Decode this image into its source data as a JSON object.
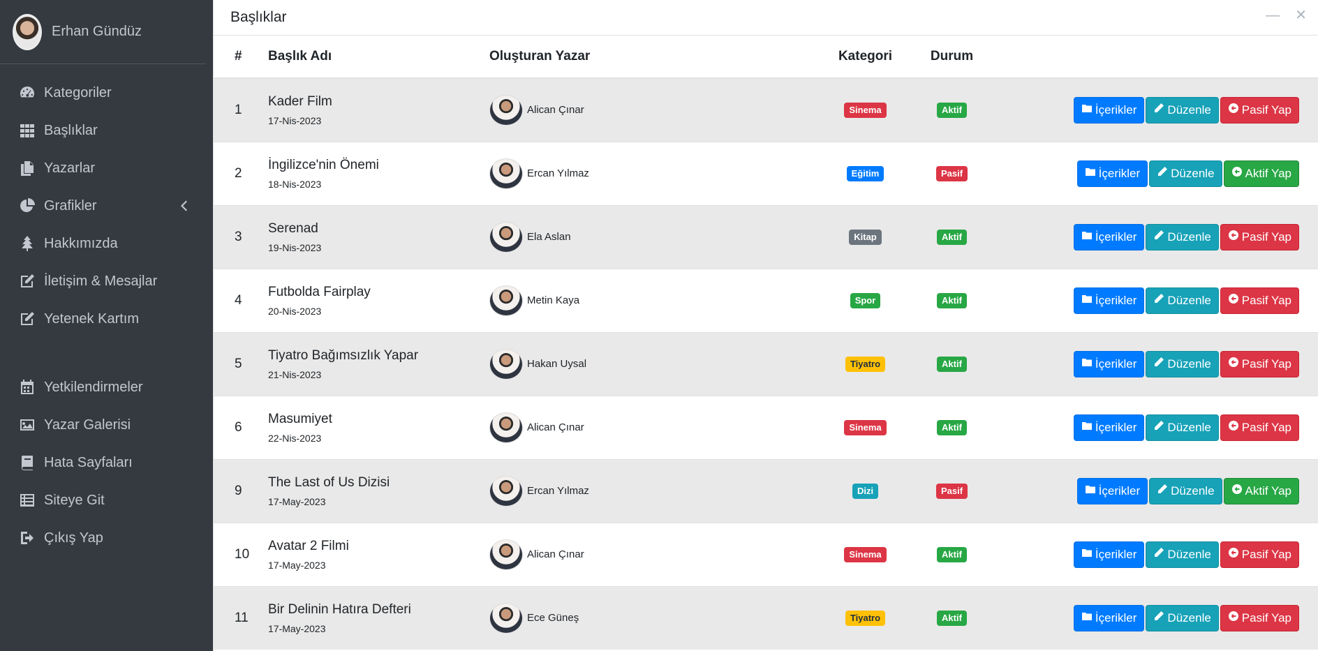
{
  "user": {
    "name": "Erhan Gündüz"
  },
  "sidebar": {
    "items": [
      {
        "label": "Kategoriler",
        "icon": "dashboard-icon"
      },
      {
        "label": "Başlıklar",
        "icon": "grid-icon"
      },
      {
        "label": "Yazarlar",
        "icon": "copy-icon"
      },
      {
        "label": "Grafikler",
        "icon": "pie-chart-icon"
      },
      {
        "label": "Hakkımızda",
        "icon": "tree-icon"
      },
      {
        "label": "İletişim & Mesajlar",
        "icon": "edit-icon"
      },
      {
        "label": "Yetenek Kartım",
        "icon": "edit-icon"
      },
      {
        "label": "Yetkilendirmeler",
        "icon": "calendar-icon"
      },
      {
        "label": "Yazar Galerisi",
        "icon": "image-icon"
      },
      {
        "label": "Hata Sayfaları",
        "icon": "book-icon"
      },
      {
        "label": "Siteye Git",
        "icon": "list-icon"
      },
      {
        "label": "Çıkış Yap",
        "icon": "sign-out-icon"
      }
    ]
  },
  "card": {
    "title": "Başlıklar",
    "minimize": "—",
    "close": "✕"
  },
  "table": {
    "headers": {
      "num": "#",
      "title": "Başlık Adı",
      "author": "Oluşturan Yazar",
      "category": "Kategori",
      "status": "Durum"
    },
    "rows": [
      {
        "num": "1",
        "title": "Kader Film",
        "date": "17-Nis-2023",
        "author": "Alican Çınar",
        "category": "Sinema",
        "cat_class": "b-red",
        "status": "Aktif",
        "stat_class": "b-green",
        "toggle": "Pasif Yap",
        "toggle_class": "btn-danger"
      },
      {
        "num": "2",
        "title": "İngilizce'nin Önemi",
        "date": "18-Nis-2023",
        "author": "Ercan Yılmaz",
        "category": "Eğitim",
        "cat_class": "b-blue",
        "status": "Pasif",
        "stat_class": "b-red",
        "toggle": "Aktif Yap",
        "toggle_class": "btn-success"
      },
      {
        "num": "3",
        "title": "Serenad",
        "date": "19-Nis-2023",
        "author": "Ela Aslan",
        "category": "Kitap",
        "cat_class": "b-gray",
        "status": "Aktif",
        "stat_class": "b-green",
        "toggle": "Pasif Yap",
        "toggle_class": "btn-danger"
      },
      {
        "num": "4",
        "title": "Futbolda Fairplay",
        "date": "20-Nis-2023",
        "author": "Metin Kaya",
        "category": "Spor",
        "cat_class": "b-green",
        "status": "Aktif",
        "stat_class": "b-green",
        "toggle": "Pasif Yap",
        "toggle_class": "btn-danger"
      },
      {
        "num": "5",
        "title": "Tiyatro Bağımsızlık Yapar",
        "date": "21-Nis-2023",
        "author": "Hakan Uysal",
        "category": "Tiyatro",
        "cat_class": "b-yellow",
        "status": "Aktif",
        "stat_class": "b-green",
        "toggle": "Pasif Yap",
        "toggle_class": "btn-danger"
      },
      {
        "num": "6",
        "title": "Masumiyet",
        "date": "22-Nis-2023",
        "author": "Alican Çınar",
        "category": "Sinema",
        "cat_class": "b-red",
        "status": "Aktif",
        "stat_class": "b-green",
        "toggle": "Pasif Yap",
        "toggle_class": "btn-danger"
      },
      {
        "num": "9",
        "title": "The Last of Us Dizisi",
        "date": "17-May-2023",
        "author": "Ercan Yılmaz",
        "category": "Dizi",
        "cat_class": "b-cyan",
        "status": "Pasif",
        "stat_class": "b-red",
        "toggle": "Aktif Yap",
        "toggle_class": "btn-success"
      },
      {
        "num": "10",
        "title": "Avatar 2 Filmi",
        "date": "17-May-2023",
        "author": "Alican Çınar",
        "category": "Sinema",
        "cat_class": "b-red",
        "status": "Aktif",
        "stat_class": "b-green",
        "toggle": "Pasif Yap",
        "toggle_class": "btn-danger"
      },
      {
        "num": "11",
        "title": "Bir Delinin Hatıra Defteri",
        "date": "17-May-2023",
        "author": "Ece Güneş",
        "category": "Tiyatro",
        "cat_class": "b-yellow",
        "status": "Aktif",
        "stat_class": "b-green",
        "toggle": "Pasif Yap",
        "toggle_class": "btn-danger"
      }
    ],
    "actions": {
      "contents": "İçerikler",
      "edit": "Düzenle"
    }
  }
}
